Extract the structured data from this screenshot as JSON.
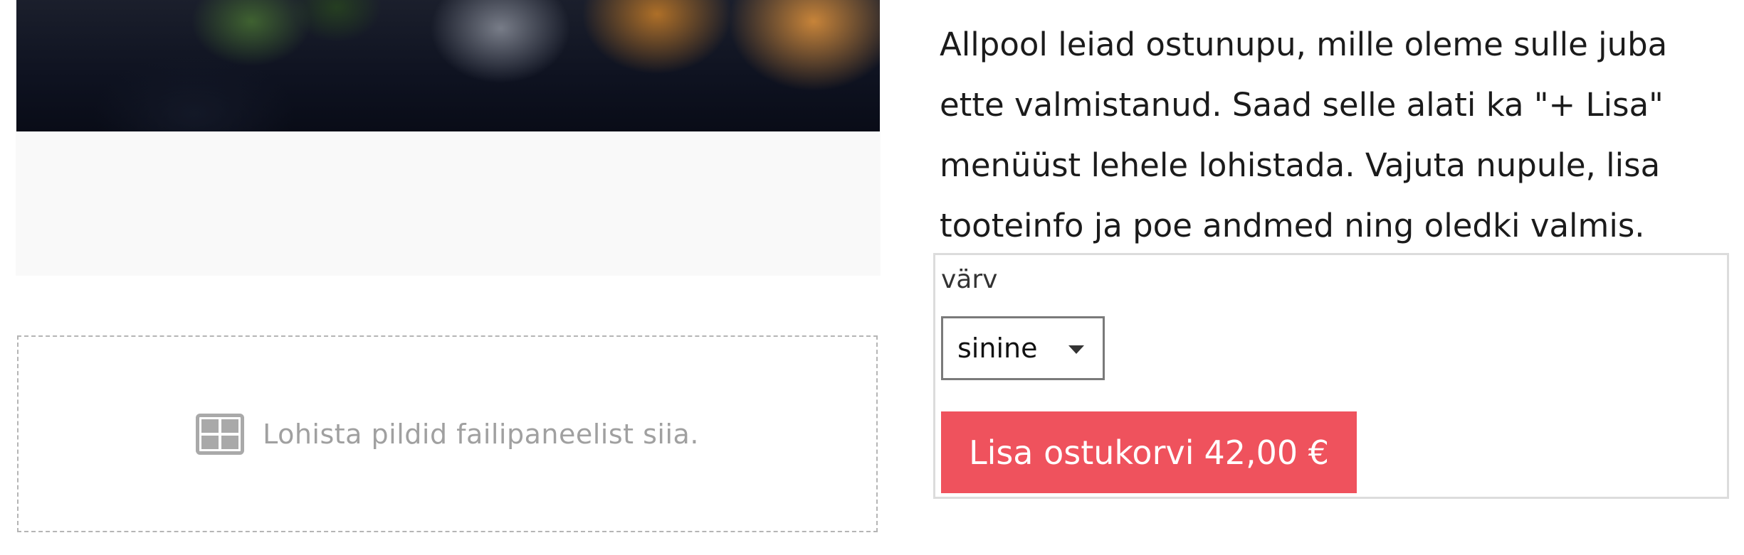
{
  "image": {
    "alt": ""
  },
  "dropzone": {
    "text": "Lohista pildid failipaneelist siia."
  },
  "description": {
    "text": "Allpool leiad ostunupu, mille oleme sulle juba ette valmistanud. Saad selle alati ka \"+ Lisa\" menüüst lehele lohistada. Vajuta nupule, lisa tooteinfo ja poe andmed ning oledki valmis."
  },
  "product": {
    "option_label": "värv",
    "option_value": "sinine",
    "button_label": "Lisa ostukorvi",
    "price": "42,00 €"
  },
  "colors": {
    "button": "#ef525d",
    "dropzone_border": "#b5b5b5",
    "panel_bg": "#f9f9f9"
  },
  "icons": {
    "dropzone": "image-grid-icon",
    "select": "chevron-down-icon"
  }
}
